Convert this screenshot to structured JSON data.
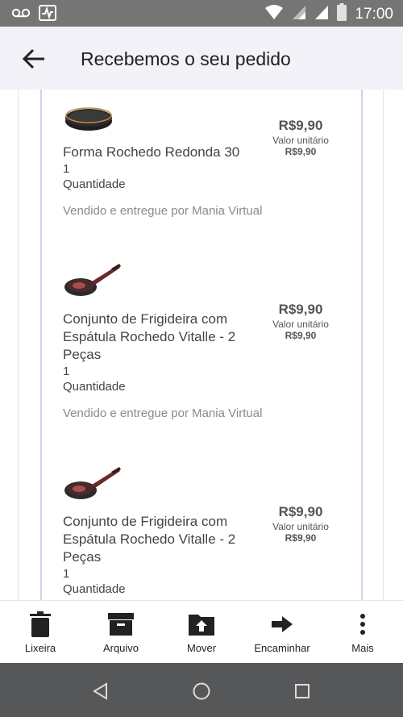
{
  "status_bar": {
    "time": "17:00",
    "icons": [
      "voicemail-icon",
      "activity-icon",
      "wifi-icon",
      "signal-icon",
      "signal-icon",
      "battery-icon"
    ]
  },
  "app_bar": {
    "title": "Recebemos o seu pedido",
    "back_icon": "arrow-back-icon"
  },
  "items": [
    {
      "image": "round-baking-pan",
      "name": "Forma Rochedo Redonda 30",
      "price": "R$9,90",
      "unit_label": "Valor unitário",
      "unit_price": "R$9,90",
      "quantity": "1",
      "quantity_label": "Quantidade",
      "seller": "Vendido e entregue por Mania Virtual"
    },
    {
      "image": "frying-pan",
      "name": "Conjunto de Frigideira com Espátula Rochedo Vitalle - 2 Peças",
      "price": "R$9,90",
      "unit_label": "Valor unitário",
      "unit_price": "R$9,90",
      "quantity": "1",
      "quantity_label": "Quantidade",
      "seller": "Vendido e entregue por Mania Virtual"
    },
    {
      "image": "frying-pan",
      "name": "Conjunto de Frigideira com Espátula Rochedo Vitalle - 2 Peças",
      "price": "R$9,90",
      "unit_label": "Valor unitário",
      "unit_price": "R$9,90",
      "quantity": "1",
      "quantity_label": "Quantidade"
    }
  ],
  "toolbar": {
    "trash_label": "Lixeira",
    "archive_label": "Arquivo",
    "move_label": "Mover",
    "forward_label": "Encaminhar",
    "more_label": "Mais"
  },
  "nav_bar": {
    "icons": [
      "nav-back-icon",
      "nav-home-icon",
      "nav-recents-icon"
    ]
  },
  "colors": {
    "status_bar": "#757575",
    "app_bar": "#f2f2f8",
    "nav_bar": "#555759",
    "rail": "#c9d7e6"
  }
}
